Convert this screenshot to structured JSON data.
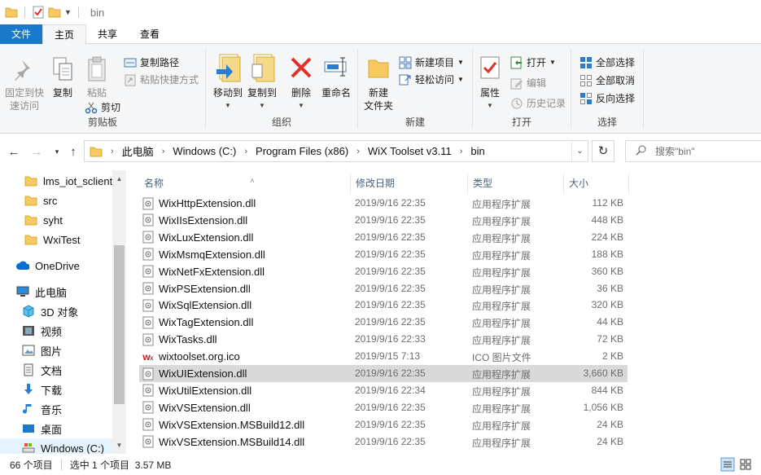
{
  "window": {
    "title": "bin"
  },
  "tabs": [
    {
      "label": "文件"
    },
    {
      "label": "主页"
    },
    {
      "label": "共享"
    },
    {
      "label": "查看"
    }
  ],
  "ribbon": {
    "clipboard": {
      "label": "剪贴板",
      "pin_label": "固定到快速访问",
      "pin_line1": "固定到快",
      "pin_line2": "速访问",
      "copy_label": "复制",
      "paste_label": "粘贴",
      "copy_path_label": "复制路径",
      "paste_shortcut_label": "粘贴快捷方式",
      "cut_label": "剪切"
    },
    "organize": {
      "label": "组织",
      "move_to_label": "移动到",
      "copy_to_label": "复制到",
      "delete_label": "删除",
      "rename_label": "重命名"
    },
    "new": {
      "label": "新建",
      "new_folder_line1": "新建",
      "new_folder_line2": "文件夹",
      "new_item_label": "新建项目",
      "easy_access_label": "轻松访问"
    },
    "open": {
      "label": "打开",
      "properties_label": "属性",
      "open_label": "打开",
      "edit_label": "编辑",
      "history_label": "历史记录"
    },
    "select": {
      "label": "选择",
      "select_all_label": "全部选择",
      "select_none_label": "全部取消",
      "invert_label": "反向选择"
    }
  },
  "address": {
    "crumbs": [
      "此电脑",
      "Windows (C:)",
      "Program Files (x86)",
      "WiX Toolset v3.11",
      "bin"
    ],
    "search_placeholder": "搜索\"bin\""
  },
  "nav": {
    "items": [
      {
        "label": "lms_iot_sclient",
        "icon": "folder-icon"
      },
      {
        "label": "src",
        "icon": "folder-icon"
      },
      {
        "label": "syht",
        "icon": "folder-icon"
      },
      {
        "label": "WxiTest",
        "icon": "folder-icon"
      },
      {
        "label": "OneDrive",
        "icon": "cloud-icon"
      },
      {
        "label": "此电脑",
        "icon": "computer-icon"
      },
      {
        "label": "3D 对象",
        "icon": "cube-icon"
      },
      {
        "label": "视频",
        "icon": "video-icon"
      },
      {
        "label": "图片",
        "icon": "picture-icon"
      },
      {
        "label": "文档",
        "icon": "document-icon"
      },
      {
        "label": "下载",
        "icon": "download-icon"
      },
      {
        "label": "音乐",
        "icon": "music-icon"
      },
      {
        "label": "桌面",
        "icon": "desktop-icon"
      },
      {
        "label": "Windows (C:)",
        "icon": "drive-icon"
      }
    ]
  },
  "columns": {
    "name": "名称",
    "date": "修改日期",
    "type": "类型",
    "size": "大小"
  },
  "files": [
    {
      "name": "WixHttpExtension.dll",
      "date": "2019/9/16 22:35",
      "type": "应用程序扩展",
      "size": "112 KB"
    },
    {
      "name": "WixIIsExtension.dll",
      "date": "2019/9/16 22:35",
      "type": "应用程序扩展",
      "size": "448 KB"
    },
    {
      "name": "WixLuxExtension.dll",
      "date": "2019/9/16 22:35",
      "type": "应用程序扩展",
      "size": "224 KB"
    },
    {
      "name": "WixMsmqExtension.dll",
      "date": "2019/9/16 22:35",
      "type": "应用程序扩展",
      "size": "188 KB"
    },
    {
      "name": "WixNetFxExtension.dll",
      "date": "2019/9/16 22:35",
      "type": "应用程序扩展",
      "size": "360 KB"
    },
    {
      "name": "WixPSExtension.dll",
      "date": "2019/9/16 22:35",
      "type": "应用程序扩展",
      "size": "36 KB"
    },
    {
      "name": "WixSqlExtension.dll",
      "date": "2019/9/16 22:35",
      "type": "应用程序扩展",
      "size": "320 KB"
    },
    {
      "name": "WixTagExtension.dll",
      "date": "2019/9/16 22:35",
      "type": "应用程序扩展",
      "size": "44 KB"
    },
    {
      "name": "WixTasks.dll",
      "date": "2019/9/16 22:33",
      "type": "应用程序扩展",
      "size": "72 KB"
    },
    {
      "name": "wixtoolset.org.ico",
      "date": "2019/9/15 7:13",
      "type": "ICO 图片文件",
      "size": "2 KB"
    },
    {
      "name": "WixUIExtension.dll",
      "date": "2019/9/16 22:35",
      "type": "应用程序扩展",
      "size": "3,660 KB"
    },
    {
      "name": "WixUtilExtension.dll",
      "date": "2019/9/16 22:34",
      "type": "应用程序扩展",
      "size": "844 KB"
    },
    {
      "name": "WixVSExtension.dll",
      "date": "2019/9/16 22:35",
      "type": "应用程序扩展",
      "size": "1,056 KB"
    },
    {
      "name": "WixVSExtension.MSBuild12.dll",
      "date": "2019/9/16 22:35",
      "type": "应用程序扩展",
      "size": "24 KB"
    },
    {
      "name": "WixVSExtension.MSBuild14.dll",
      "date": "2019/9/16 22:35",
      "type": "应用程序扩展",
      "size": "24 KB"
    }
  ],
  "status": {
    "item_count": "66 个项目",
    "selection": "选中 1 个项目  3.57 MB"
  },
  "colors": {
    "file_tab": "#1979ca",
    "selection": "#d9d9d9",
    "folder": "#f7c960"
  }
}
